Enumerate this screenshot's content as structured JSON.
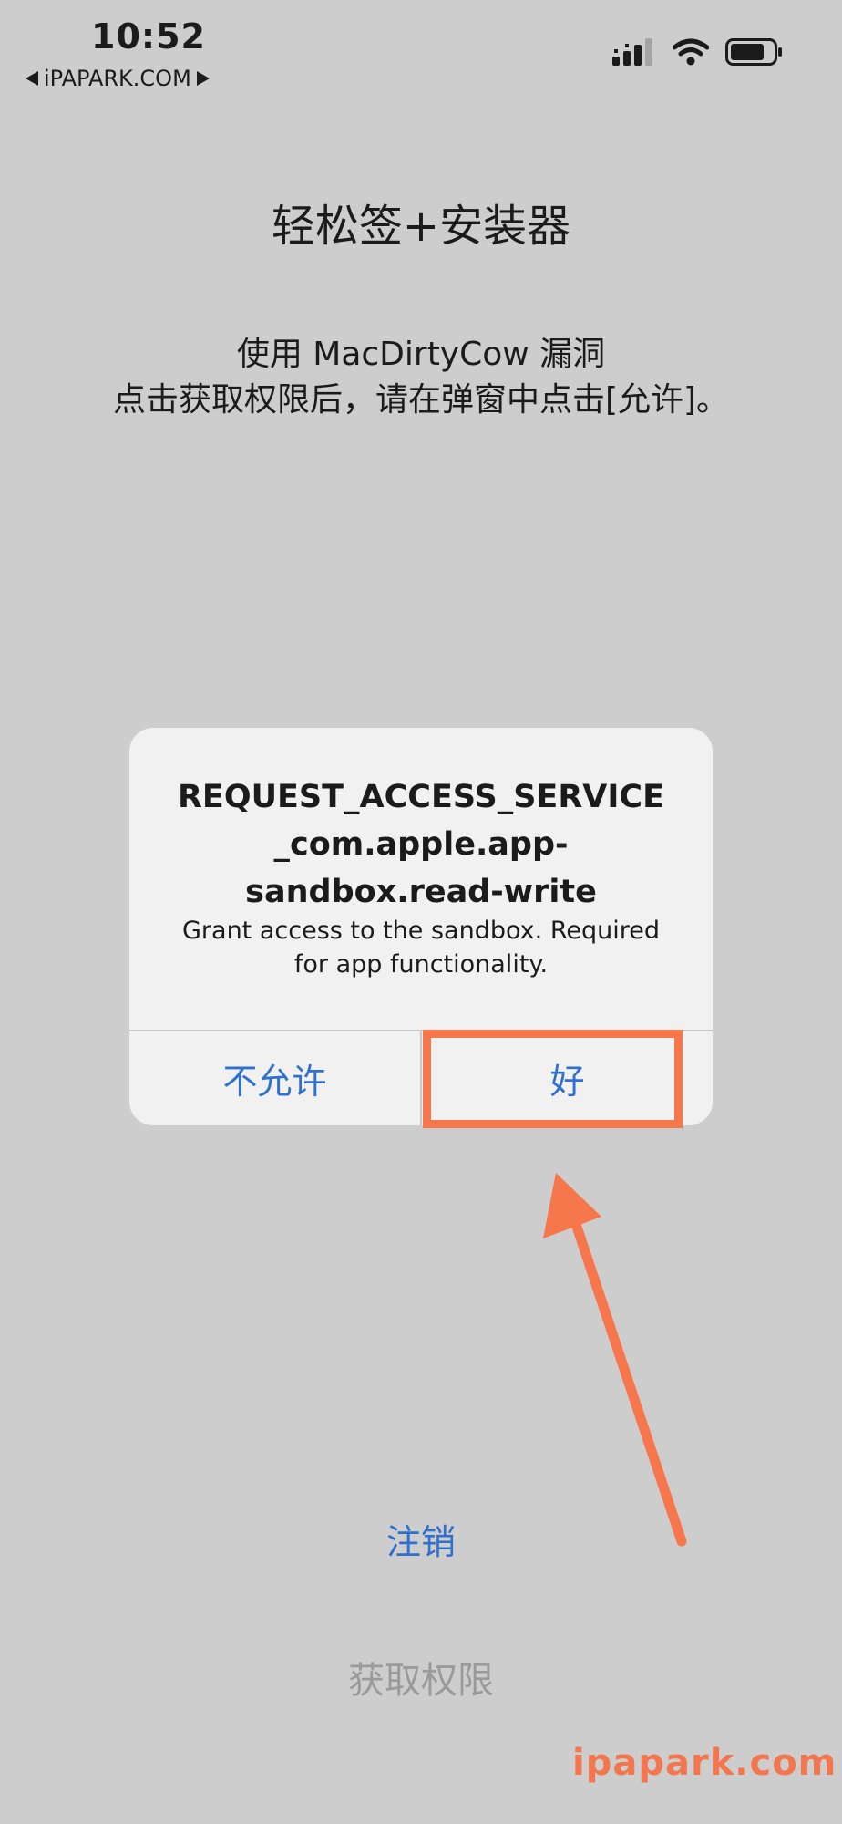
{
  "status_bar": {
    "time": "10:52",
    "back_label": "iPAPARK.COM"
  },
  "app": {
    "title": "轻松签+安装器",
    "description_lines": [
      "使用 MacDirtyCow 漏洞",
      "点击获取权限后，请在弹窗中点击[允许]。"
    ]
  },
  "alert": {
    "title_lines": [
      "REQUEST_ACCESS_SERVICE",
      "_com.apple.app-",
      "sandbox.read-write"
    ],
    "message_lines": [
      "Grant access to the sandbox. Required",
      "for app functionality."
    ],
    "deny_label": "不允许",
    "allow_label": "好"
  },
  "buttons": {
    "logout_label": "注销",
    "obtain_permission_label": "获取权限"
  },
  "watermark": "ipapark.com",
  "colors": {
    "background": "#cdcdcd",
    "alert_bg": "#f1f1f1",
    "accent_blue": "#2f6fcd",
    "annotation_orange": "#f6774c",
    "disabled_gray": "#9a9a9a"
  },
  "icons": [
    "back-chevron-icon",
    "forward-chevron-icon",
    "cellular-signal-icon",
    "wifi-icon",
    "battery-icon",
    "annotation-arrow"
  ]
}
